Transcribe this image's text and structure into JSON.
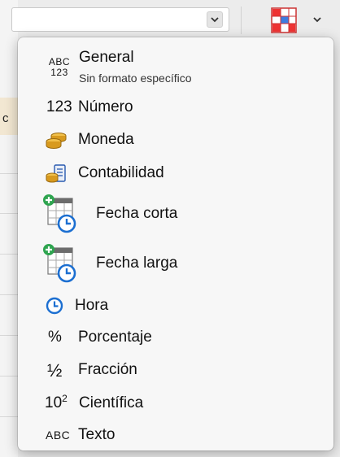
{
  "toolbar": {
    "format_select_value": "",
    "format_select_icon": "chevron-down-icon",
    "conditional_format_icon": "conditional-format-icon"
  },
  "background": {
    "cell_text": "c"
  },
  "menu": {
    "items": [
      {
        "label": "General",
        "sublabel": "Sin formato específico",
        "icon_text_top": "ABC",
        "icon_text_bottom": "123"
      },
      {
        "label": "Número",
        "icon_text": "123"
      },
      {
        "label": "Moneda",
        "icon": "coins-icon"
      },
      {
        "label": "Contabilidad",
        "icon": "accounting-icon"
      },
      {
        "label": "Fecha corta",
        "icon": "calendar-clock-icon"
      },
      {
        "label": "Fecha larga",
        "icon": "calendar-clock-icon"
      },
      {
        "label": "Hora",
        "icon": "clock-icon"
      },
      {
        "label": "Porcentaje",
        "icon_text": "%"
      },
      {
        "label": "Fracción",
        "icon_text": "½"
      },
      {
        "label": "Científica",
        "icon_text_base": "10",
        "icon_text_sup": "2"
      },
      {
        "label": "Texto",
        "icon_text": "ABC"
      }
    ]
  },
  "colors": {
    "accent_blue": "#1c6fd1",
    "coin_gold": "#d89a1e",
    "plus_green": "#2ea44f"
  }
}
